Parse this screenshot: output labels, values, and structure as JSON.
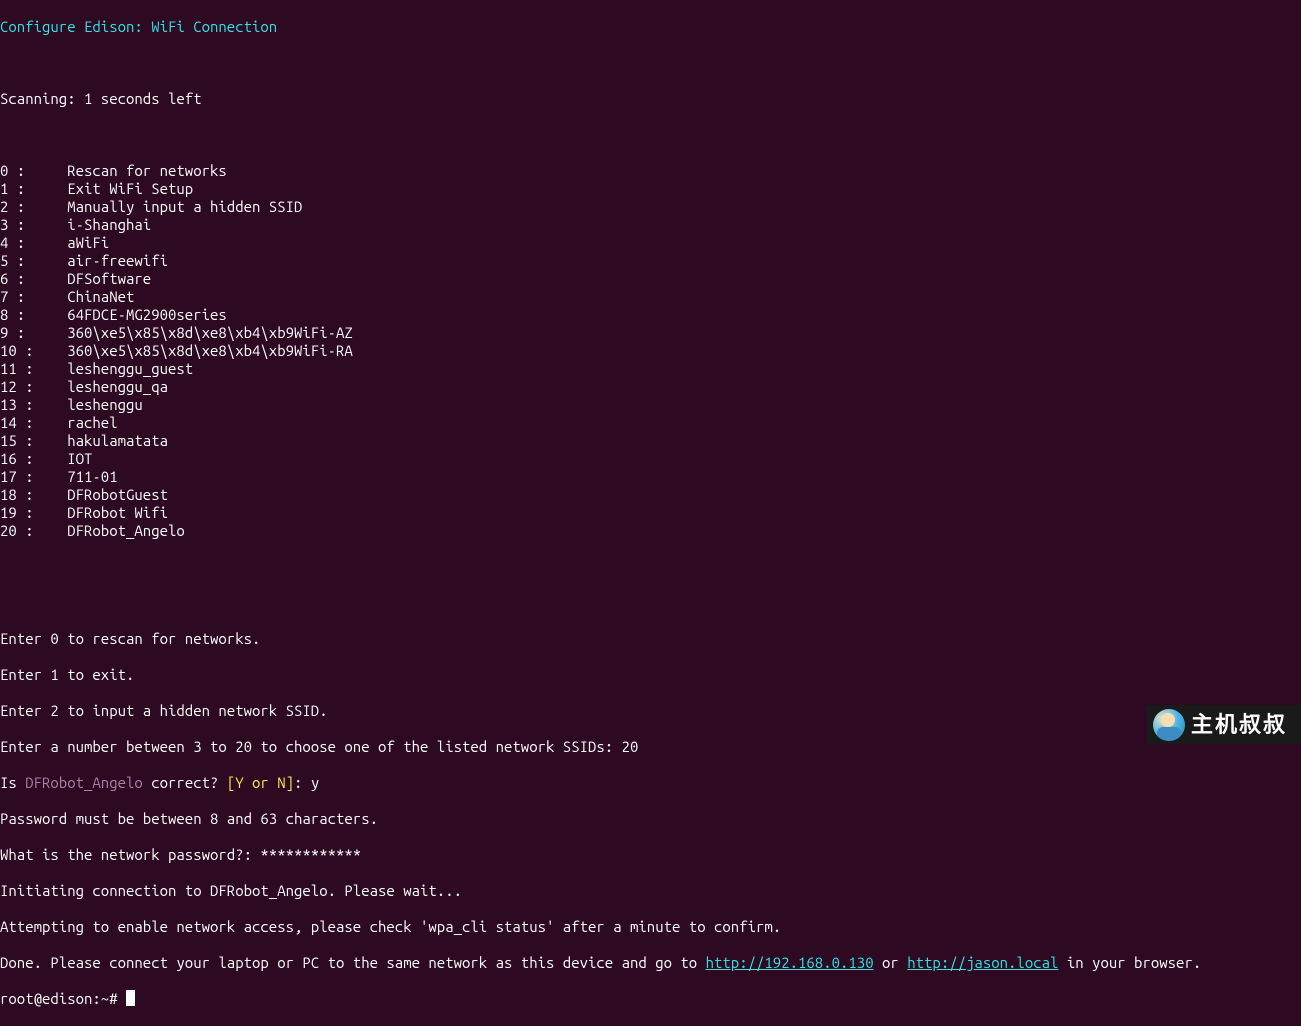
{
  "header": "Configure Edison: WiFi Connection",
  "scanning": "Scanning: 1 seconds left",
  "menu": [
    {
      "idx": "0 :",
      "label": "Rescan for networks"
    },
    {
      "idx": "1 :",
      "label": "Exit WiFi Setup"
    },
    {
      "idx": "2 :",
      "label": "Manually input a hidden SSID"
    },
    {
      "idx": "3 :",
      "label": "i-Shanghai"
    },
    {
      "idx": "4 :",
      "label": "aWiFi"
    },
    {
      "idx": "5 :",
      "label": "air-freewifi"
    },
    {
      "idx": "6 :",
      "label": "DFSoftware"
    },
    {
      "idx": "7 :",
      "label": "ChinaNet"
    },
    {
      "idx": "8 :",
      "label": "64FDCE-MG2900series"
    },
    {
      "idx": "9 :",
      "label": "360\\xe5\\x85\\x8d\\xe8\\xb4\\xb9WiFi-AZ"
    },
    {
      "idx": "10 :",
      "label": "360\\xe5\\x85\\x8d\\xe8\\xb4\\xb9WiFi-RA"
    },
    {
      "idx": "11 :",
      "label": "leshenggu_guest"
    },
    {
      "idx": "12 :",
      "label": "leshenggu_qa"
    },
    {
      "idx": "13 :",
      "label": "leshenggu"
    },
    {
      "idx": "14 :",
      "label": "rachel"
    },
    {
      "idx": "15 :",
      "label": "hakulamatata"
    },
    {
      "idx": "16 :",
      "label": "IOT"
    },
    {
      "idx": "17 :",
      "label": "711-01"
    },
    {
      "idx": "18 :",
      "label": "DFRobotGuest"
    },
    {
      "idx": "19 :",
      "label": "DFRobot Wifi"
    },
    {
      "idx": "20 :",
      "label": "DFRobot_Angelo"
    }
  ],
  "prompts": {
    "p1": "Enter 0 to rescan for networks.",
    "p2": "Enter 1 to exit.",
    "p3": "Enter 2 to input a hidden network SSID.",
    "p4": "Enter a number between 3 to 20 to choose one of the listed network SSIDs: 20",
    "is": "Is ",
    "ssid": "DFRobot_Angelo",
    "correct": " correct? ",
    "yn": "[Y or N]",
    "yn_after": ": y",
    "pwlen": "Password must be between 8 and 63 characters.",
    "pwq": "What is the network password?: ************",
    "init": "Initiating connection to DFRobot_Angelo. Please wait...",
    "attempt": "Attempting to enable network access, please check 'wpa_cli status' after a minute to confirm.",
    "done_a": "Done. Please connect your laptop or PC to the same network as this device and go to ",
    "url1": "http://192.168.0.130",
    "done_or": " or ",
    "url2": "http://jason.local",
    "done_b": " in your browser.",
    "ps1": "root@edison:~# "
  },
  "watermark": "主机叔叔"
}
